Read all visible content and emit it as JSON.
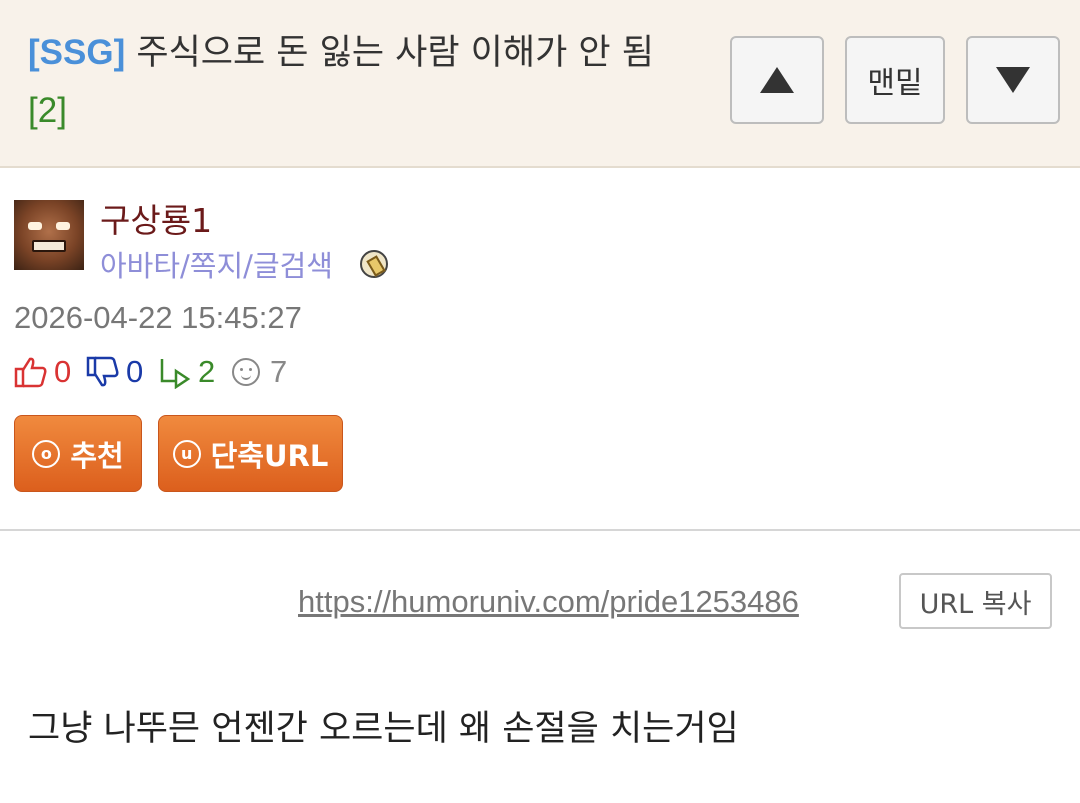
{
  "post": {
    "tag": "[SSG]",
    "title": "주식으로 돈 잃는 사람 이해가 안 됨",
    "comment_count": "[2]"
  },
  "nav": {
    "up_icon": "triangle-up-icon",
    "bottom_label": "맨밑",
    "down_icon": "triangle-down-icon"
  },
  "author": {
    "name": "구상룡1",
    "links": "아바타/쪽지/글검색",
    "avatar_icon": "avatar-face",
    "badge_icon": "scroll-badge-icon"
  },
  "meta": {
    "date": "2026-04-22 15:45:27",
    "likes": "0",
    "dislikes": "0",
    "replies": "2",
    "views": "7"
  },
  "buttons": {
    "recommend_icon": "o",
    "recommend_label": "추천",
    "shorturl_icon": "u",
    "shorturl_label": "단축URL"
  },
  "url": {
    "link": "https://humoruniv.com/pride1253486",
    "copy_label": "URL 복사"
  },
  "body": {
    "text": "그냥 나뚜믄 언젠간 오르는데 왜 손절을 치는거임"
  },
  "colors": {
    "tag": "#4a90d9",
    "comment_count": "#3a8a2a",
    "author": "#6b1a1a",
    "author_links": "#8e8ed8",
    "header_bg": "#f8f2ea",
    "button_orange": "#e8702a"
  }
}
